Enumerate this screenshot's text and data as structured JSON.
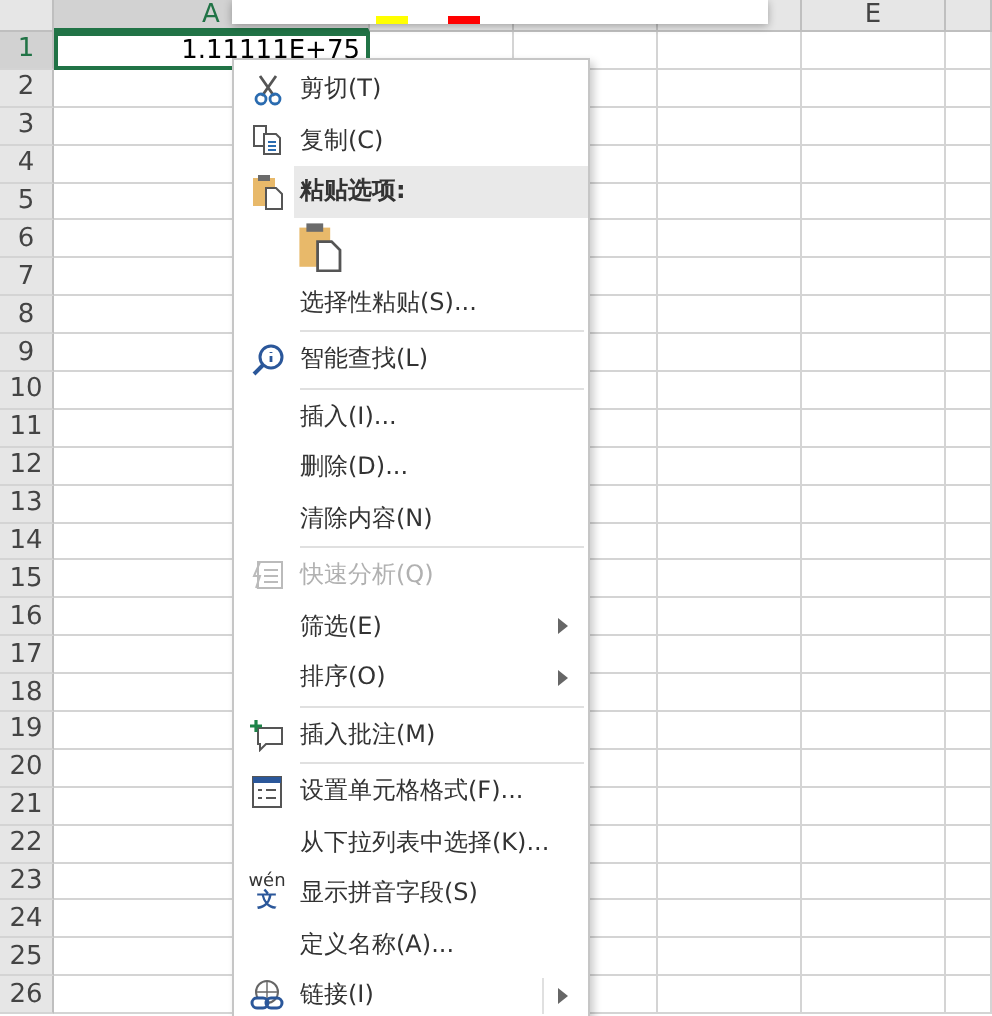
{
  "columns": [
    {
      "label": "A",
      "selected": true
    },
    {
      "selected": false
    },
    {
      "selected": false
    },
    {
      "selected": false
    },
    {
      "label": "E",
      "selected": false
    }
  ],
  "rows": [
    {
      "label": "1",
      "selected": true
    },
    {
      "label": "2",
      "selected": false
    },
    {
      "label": "3",
      "selected": false
    },
    {
      "label": "4",
      "selected": false
    },
    {
      "label": "5",
      "selected": false
    },
    {
      "label": "6",
      "selected": false
    },
    {
      "label": "7",
      "selected": false
    },
    {
      "label": "8",
      "selected": false
    },
    {
      "label": "9",
      "selected": false
    },
    {
      "label": "10",
      "selected": false
    },
    {
      "label": "11",
      "selected": false
    },
    {
      "label": "12",
      "selected": false
    },
    {
      "label": "13",
      "selected": false
    },
    {
      "label": "14",
      "selected": false
    },
    {
      "label": "15",
      "selected": false
    },
    {
      "label": "16",
      "selected": false
    },
    {
      "label": "17",
      "selected": false
    },
    {
      "label": "18",
      "selected": false
    },
    {
      "label": "19",
      "selected": false
    },
    {
      "label": "20",
      "selected": false
    },
    {
      "label": "21",
      "selected": false
    },
    {
      "label": "22",
      "selected": false
    },
    {
      "label": "23",
      "selected": false
    },
    {
      "label": "24",
      "selected": false
    },
    {
      "label": "25",
      "selected": false
    },
    {
      "label": "26",
      "selected": false
    }
  ],
  "active_cell": {
    "value": "1.11111E+75"
  },
  "mini_toolbar": {
    "swatches": [
      {
        "color": "#ffff00"
      },
      {
        "color": "#ff0000"
      }
    ]
  },
  "context_menu": [
    {
      "kind": "item",
      "label": "剪切(T)",
      "disabled": false,
      "submenu": false
    },
    {
      "kind": "item",
      "label": "复制(C)",
      "disabled": false,
      "submenu": false
    },
    {
      "kind": "header",
      "label": "粘贴选项:"
    },
    {
      "kind": "paste-options"
    },
    {
      "kind": "item",
      "label": "选择性粘贴(S)...",
      "disabled": false,
      "submenu": false
    },
    {
      "kind": "separator"
    },
    {
      "kind": "item",
      "label": "智能查找(L)",
      "disabled": false,
      "submenu": false
    },
    {
      "kind": "separator"
    },
    {
      "kind": "item",
      "label": "插入(I)...",
      "disabled": false,
      "submenu": false
    },
    {
      "kind": "item",
      "label": "删除(D)...",
      "disabled": false,
      "submenu": false
    },
    {
      "kind": "item",
      "label": "清除内容(N)",
      "disabled": false,
      "submenu": false
    },
    {
      "kind": "separator"
    },
    {
      "kind": "item",
      "label": "快速分析(Q)",
      "disabled": true,
      "submenu": false
    },
    {
      "kind": "item",
      "label": "筛选(E)",
      "disabled": false,
      "submenu": true
    },
    {
      "kind": "item",
      "label": "排序(O)",
      "disabled": false,
      "submenu": true
    },
    {
      "kind": "separator"
    },
    {
      "kind": "item",
      "label": "插入批注(M)",
      "disabled": false,
      "submenu": false
    },
    {
      "kind": "separator"
    },
    {
      "kind": "item",
      "label": "设置单元格格式(F)...",
      "disabled": false,
      "submenu": false
    },
    {
      "kind": "item",
      "label": "从下拉列表中选择(K)...",
      "disabled": false,
      "submenu": false
    },
    {
      "kind": "item",
      "icon_text": [
        "wén",
        "文"
      ],
      "label": "显示拼音字段(S)",
      "disabled": false,
      "submenu": false
    },
    {
      "kind": "item",
      "label": "定义名称(A)...",
      "disabled": false,
      "submenu": false
    },
    {
      "kind": "item",
      "label": "链接(I)",
      "disabled": false,
      "submenu": true,
      "split": true
    }
  ]
}
